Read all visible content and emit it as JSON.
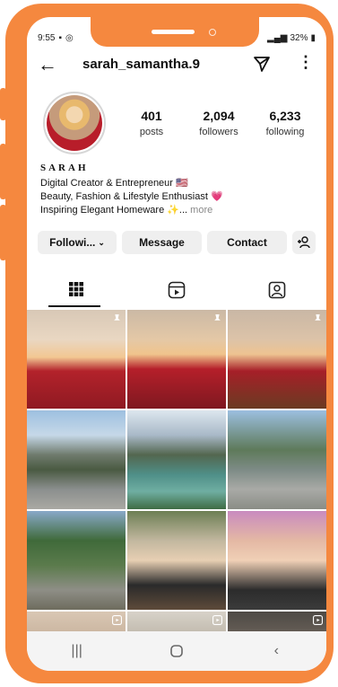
{
  "status": {
    "time": "9:55",
    "battery": "32%"
  },
  "header": {
    "username": "sarah_samantha.9"
  },
  "stats": [
    {
      "value": "401",
      "label": "posts"
    },
    {
      "value": "2,094",
      "label": "followers"
    },
    {
      "value": "6,233",
      "label": "following"
    }
  ],
  "bio": {
    "name": "SARAH",
    "line1": "Digital Creator & Entrepreneur 🇺🇸",
    "line2": "Beauty, Fashion & Lifestyle Enthusiast 💗",
    "line3": "Inspiring Elegant Homeware ✨...",
    "more": "more"
  },
  "actions": {
    "following": "Followi...",
    "message": "Message",
    "contact": "Contact"
  },
  "tabs": [
    "grid-icon",
    "reels-icon",
    "tagged-icon"
  ],
  "colors": {
    "frame": "#f5883f",
    "button_bg": "#efefef",
    "text": "#111111",
    "muted": "#8a8a8a"
  }
}
